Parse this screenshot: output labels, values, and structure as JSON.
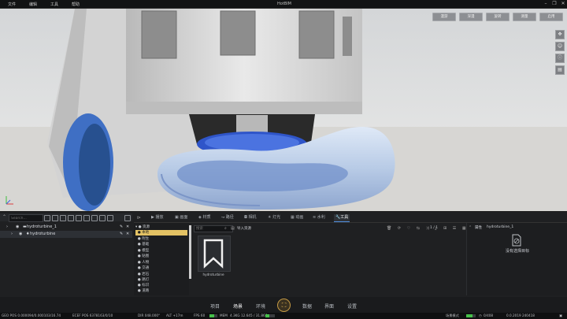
{
  "menubar": {
    "items": [
      "文件",
      "编辑",
      "工具",
      "帮助"
    ],
    "title": "HotBIM"
  },
  "viewport": {
    "top_buttons": [
      "漫游",
      "深漫",
      "旋转",
      "测量",
      "启用"
    ]
  },
  "left_panel": {
    "search_placeholder": "Search...",
    "tree": [
      {
        "label": "hydroturbine_1"
      },
      {
        "label": "hydroturbine"
      }
    ]
  },
  "tabs": [
    "播放",
    "画面",
    "材质",
    "路径",
    "相机",
    "灯光",
    "动画",
    "水利",
    "工具"
  ],
  "active_tab": "工具",
  "resources": {
    "root": "资源",
    "items": [
      "本地",
      "附生",
      "基础",
      "模型",
      "贴图",
      "人物",
      "交通",
      "岩石",
      "路灯",
      "标识",
      "道路"
    ],
    "selected": "本地"
  },
  "content": {
    "search_placeholder": "搜索",
    "import_label": "导入资源",
    "pagination": "1 / 1",
    "asset_name": "hydroturbine"
  },
  "properties": {
    "header": "属性",
    "object": "hydroturbine_1",
    "empty_text": "没有选择目标"
  },
  "bottom_nav": [
    "项目",
    "场景",
    "环境",
    "数据",
    "界面",
    "设置"
  ],
  "active_nav": "场景",
  "status": {
    "geo_pos": "GEO POS  0.000094/0.000103/16.74",
    "ecef_pos": "ECEF POS  6378163/0/10",
    "dir": "DIR  048.000°",
    "alt": "ALT  +17m",
    "fps_label": "FPS  60",
    "mem_label": "MEM",
    "mem_value": "4.3KG  12.645 / 31.866",
    "fps_fill": 0.6,
    "mem_fill": 0.4,
    "cache_label": "场景模式",
    "speed": "0/408",
    "time": "0.0.2019 240418"
  }
}
